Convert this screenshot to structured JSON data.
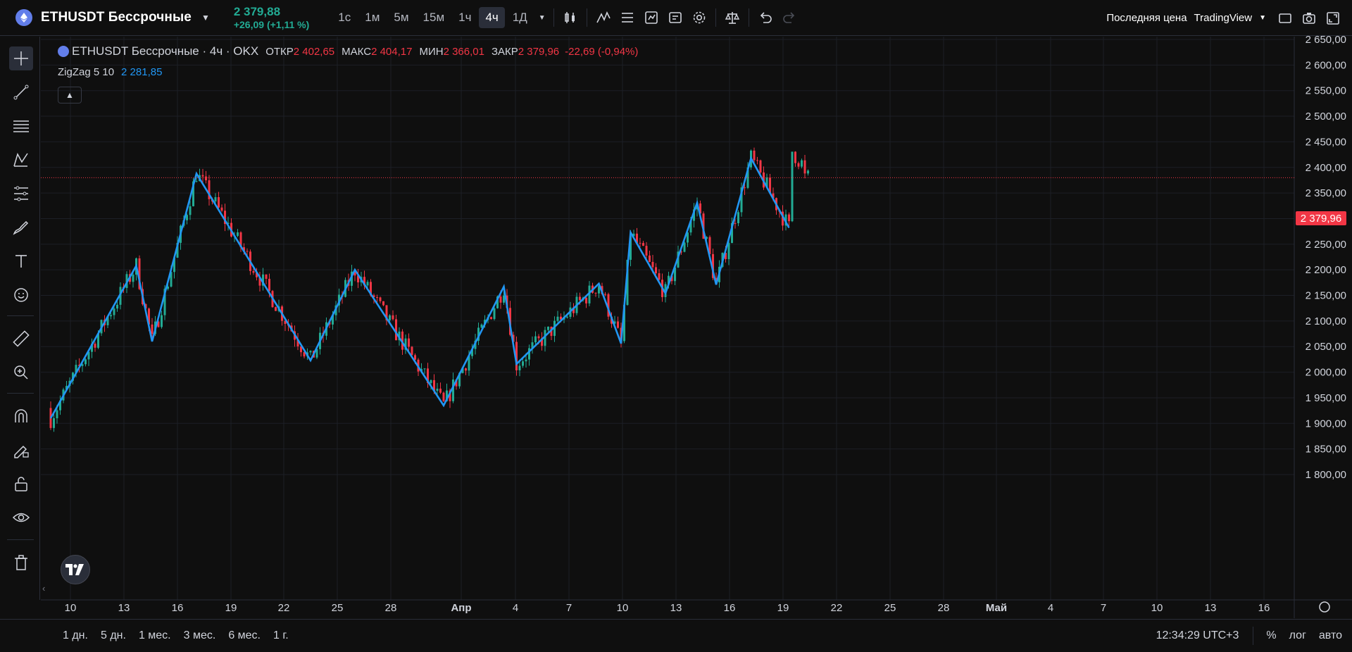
{
  "header": {
    "symbol": "ETHUSDT Бессрочные",
    "last_price": "2 379,88",
    "change": "+26,09 (+1,11 %)",
    "intervals": [
      "1с",
      "1м",
      "5м",
      "15м",
      "1ч",
      "4ч",
      "1Д"
    ],
    "active_interval": "4ч",
    "price_source": "Последняя цена",
    "chart_brand": "TradingView"
  },
  "legend": {
    "title": "ETHUSDT Бессрочные · 4ч · OKX",
    "open_label": "ОТКР",
    "open": "2 402,65",
    "high_label": "МАКС",
    "high": "2 404,17",
    "low_label": "МИН",
    "low": "2 366,01",
    "close_label": "ЗАКР",
    "close": "2 379,96",
    "change": "-22,69 (-0,94%)",
    "indicator_name": "ZigZag 5 10",
    "indicator_value": "2 281,85"
  },
  "price_axis": {
    "labels": [
      "2 650,00",
      "2 600,00",
      "2 550,00",
      "2 500,00",
      "2 450,00",
      "2 400,00",
      "2 350,00",
      "2 300,00",
      "2 250,00",
      "2 200,00",
      "2 150,00",
      "2 100,00",
      "2 050,00",
      "2 000,00",
      "1 950,00",
      "1 900,00",
      "1 850,00",
      "1 800,00"
    ],
    "current_label": "2 379,96"
  },
  "time_axis": {
    "labels": [
      "10",
      "13",
      "16",
      "19",
      "22",
      "25",
      "28",
      "Апр",
      "4",
      "7",
      "10",
      "13",
      "16",
      "19",
      "22",
      "25",
      "28",
      "Май",
      "4",
      "7",
      "10",
      "13",
      "16"
    ]
  },
  "bottom": {
    "ranges": [
      "1 дн.",
      "5 дн.",
      "1 мес.",
      "3 мес.",
      "6 мес.",
      "1 г."
    ],
    "clock": "12:34:29 UTC+3",
    "percent": "%",
    "log": "лог",
    "auto": "авто"
  },
  "colors": {
    "up": "#22ab94",
    "down": "#f23645",
    "zigzag": "#2196f3",
    "background": "#0f0f0f"
  },
  "chart_data": {
    "type": "candlestick",
    "zigzag": {
      "name": "ZigZag 5 10",
      "points": [
        {
          "i": 0,
          "y": 1910
        },
        {
          "i": 27,
          "y": 2208
        },
        {
          "i": 32,
          "y": 2060
        },
        {
          "i": 46,
          "y": 2388
        },
        {
          "i": 82,
          "y": 2023
        },
        {
          "i": 96,
          "y": 2200
        },
        {
          "i": 124,
          "y": 1935
        },
        {
          "i": 143,
          "y": 2167
        },
        {
          "i": 147,
          "y": 2016
        },
        {
          "i": 173,
          "y": 2173
        },
        {
          "i": 180,
          "y": 2056
        },
        {
          "i": 183,
          "y": 2273
        },
        {
          "i": 194,
          "y": 2154
        },
        {
          "i": 204,
          "y": 2331
        },
        {
          "i": 210,
          "y": 2171
        },
        {
          "i": 221,
          "y": 2418
        },
        {
          "i": 233,
          "y": 2282
        }
      ]
    },
    "last_close": 2379.96,
    "ylim": [
      1780,
      2660
    ]
  }
}
